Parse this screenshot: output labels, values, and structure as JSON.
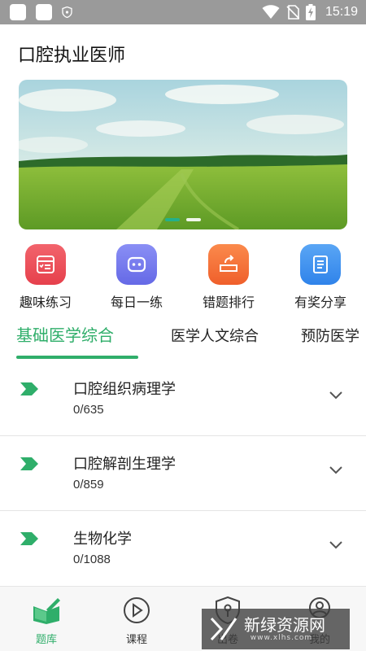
{
  "status_bar": {
    "time": "15:19"
  },
  "header": {
    "title": "口腔执业医师"
  },
  "banner": {
    "slide_count": 2,
    "active_slide": 1
  },
  "quick_menu": [
    {
      "label": "趣味练习",
      "icon": "practice-sheet-icon",
      "color": "#ee4b56"
    },
    {
      "label": "每日一练",
      "icon": "robot-face-icon",
      "color": "#6e73ea"
    },
    {
      "label": "错题排行",
      "icon": "ranking-tray-icon",
      "color": "#f26b34"
    },
    {
      "label": "有奖分享",
      "icon": "notebook-icon",
      "color": "#3b8ff0"
    }
  ],
  "tabs": [
    {
      "label": "基础医学综合",
      "active": true
    },
    {
      "label": "医学人文综合",
      "active": false
    },
    {
      "label": "预防医学",
      "active": false
    }
  ],
  "subjects": [
    {
      "title": "口腔组织病理学",
      "progress": "0/635"
    },
    {
      "title": "口腔解剖生理学",
      "progress": "0/859"
    },
    {
      "title": "生物化学",
      "progress": "0/1088"
    }
  ],
  "bottom_nav": [
    {
      "label": "题库",
      "icon": "book-pen-icon",
      "active": true
    },
    {
      "label": "课程",
      "icon": "play-circle-icon",
      "active": false
    },
    {
      "label": "出卷",
      "icon": "shield-key-icon",
      "active": false
    },
    {
      "label": "我的",
      "icon": "person-icon",
      "active": false
    }
  ],
  "watermark": {
    "text": "新绿资源网",
    "sub": "www.xlhs.com"
  },
  "colors": {
    "accent": "#2fae6a",
    "divider": "#e4e4e4",
    "status_bar": "#9a9a9a"
  }
}
